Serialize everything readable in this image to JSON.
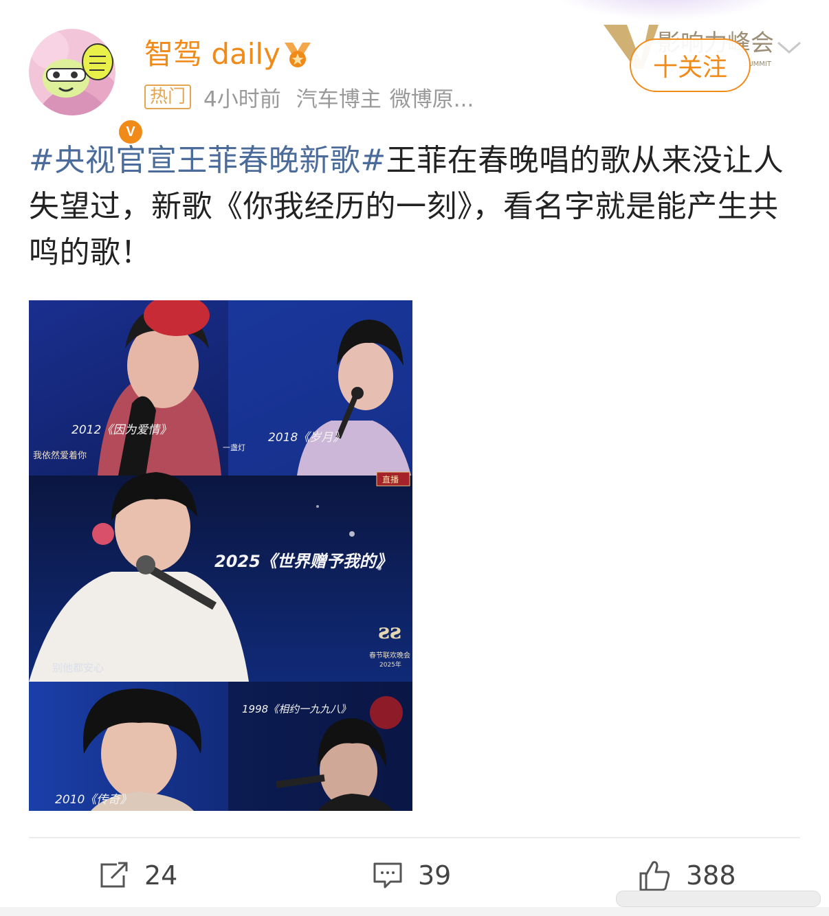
{
  "post": {
    "author": "智驾 daily",
    "hot_tag": "热门",
    "time": "4小时前",
    "author_tag": "汽车博主",
    "source": "微博原...",
    "follow_label": "十关注",
    "topic": "#央视官宣王菲春晚新歌#",
    "body": "王菲在春晚唱的歌从来没让人失望过，新歌《你我经历的一刻》，看名字就是能产生共鸣的歌！"
  },
  "badge_overlay": {
    "text": "影响力峰会",
    "sub": "SUMMIT"
  },
  "image": {
    "caption_2012": "2012《因为爱情》",
    "caption_2018": "2018《岁月》",
    "caption_2025": "2025《世界赠予我的》",
    "caption_1998": "1998《相约一九九八》",
    "caption_2010": "2010《传奇》",
    "subtitle_left": "我依然爱着你",
    "subtitle_mid": "一盏灯",
    "subtitle_2025": "别他都安心",
    "live_badge": "直播",
    "gala_line1": "春节联欢晚会",
    "gala_line2": "2025年"
  },
  "actions": {
    "repost_count": "24",
    "comment_count": "39",
    "like_count": "388"
  },
  "colors": {
    "accent": "#f08a19",
    "topic": "#4b6c9b",
    "meta": "#999999"
  }
}
